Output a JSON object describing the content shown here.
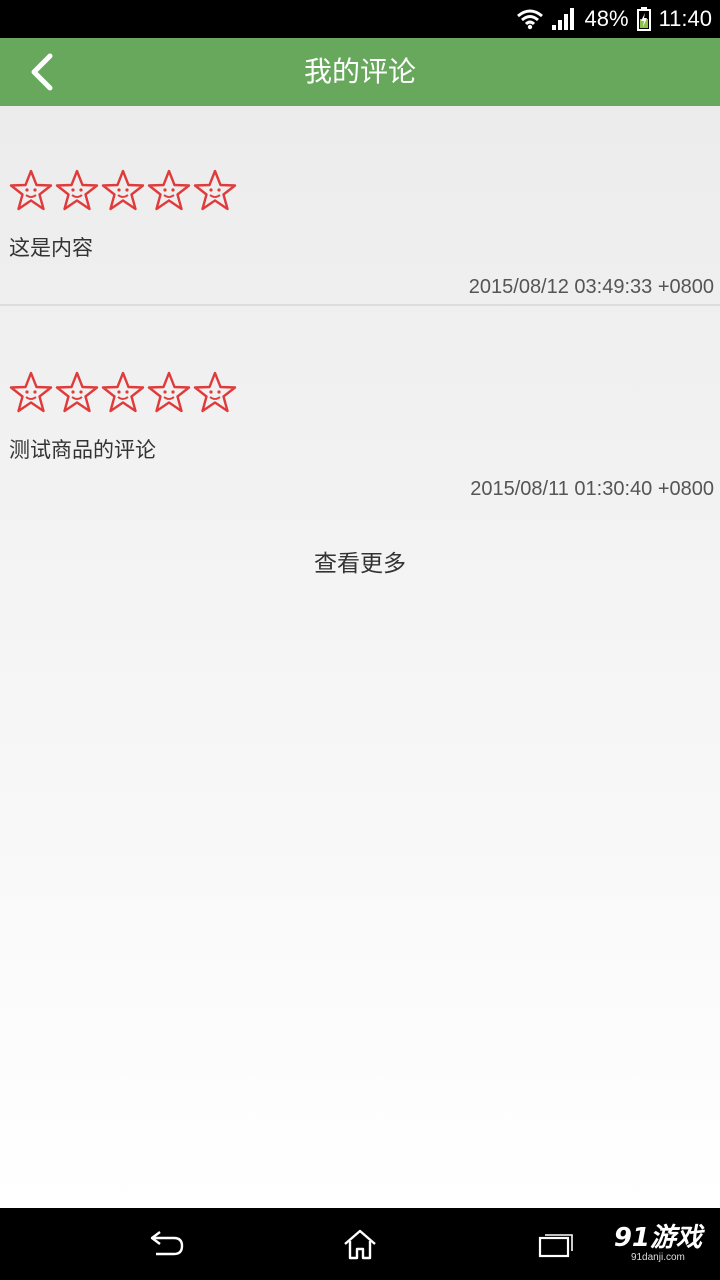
{
  "status_bar": {
    "battery_percent": "48%",
    "time": "11:40"
  },
  "header": {
    "title": "我的评论"
  },
  "reviews": [
    {
      "rating": 5,
      "max_rating": 5,
      "text": "这是内容",
      "timestamp": "2015/08/12 03:49:33 +0800"
    },
    {
      "rating": 5,
      "max_rating": 5,
      "text": "测试商品的评论",
      "timestamp": "2015/08/11 01:30:40 +0800"
    }
  ],
  "load_more": {
    "label": "查看更多"
  },
  "watermark": {
    "main": "91游戏",
    "sub": "91danji.com"
  },
  "colors": {
    "app_bar": "#67a85d",
    "star": "#e03b3b",
    "status_bar": "#000000"
  },
  "icons": {
    "back": "chevron-left-icon",
    "wifi": "wifi-icon",
    "signal": "signal-icon",
    "battery": "battery-charging-icon",
    "nav_back": "nav-back-icon",
    "nav_home": "home-icon",
    "nav_recents": "recents-icon",
    "star": "smiley-star-icon"
  }
}
